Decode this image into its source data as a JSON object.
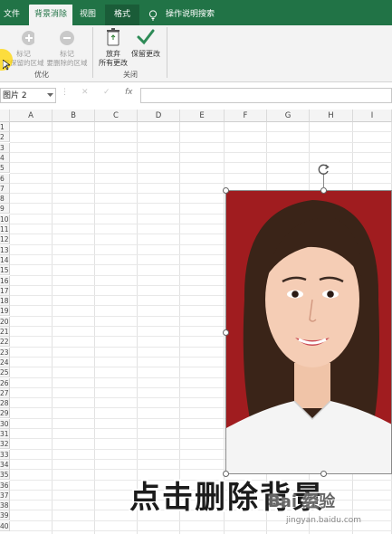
{
  "ribbon_tabs": {
    "file": "文件",
    "background_removal": "背景消除",
    "view": "视图",
    "format": "格式",
    "tell_me": "操作说明搜索"
  },
  "ribbon": {
    "mark_keep_line1": "标记",
    "mark_keep_line2": "要保留的区域",
    "mark_remove_line1": "标记",
    "mark_remove_line2": "要删除的区域",
    "refine_group": "优化",
    "discard_line1": "放弃",
    "discard_line2": "所有更改",
    "keep_changes": "保留更改",
    "close_group": "关闭"
  },
  "formula_bar": {
    "name_box": "图片 2",
    "fx": "fx",
    "cancel": "✕",
    "enter": "✓"
  },
  "columns": [
    "A",
    "B",
    "C",
    "D",
    "E",
    "F",
    "G",
    "H",
    "I"
  ],
  "rows": [
    "1",
    "2",
    "3",
    "4",
    "5",
    "6",
    "7",
    "8",
    "9",
    "10",
    "11",
    "12",
    "13",
    "14",
    "15",
    "16",
    "17",
    "18",
    "19",
    "20",
    "21",
    "22",
    "23",
    "24",
    "25",
    "26",
    "27",
    "28",
    "29",
    "30",
    "31",
    "32",
    "33",
    "34",
    "35",
    "36",
    "37",
    "38",
    "39",
    "40"
  ],
  "caption": "点击删除背景",
  "watermark": {
    "brand": "Bai 经验",
    "url": "jingyan.baidu.com"
  },
  "colors": {
    "accent": "#217346",
    "photo_background": "#9b1a1d"
  }
}
